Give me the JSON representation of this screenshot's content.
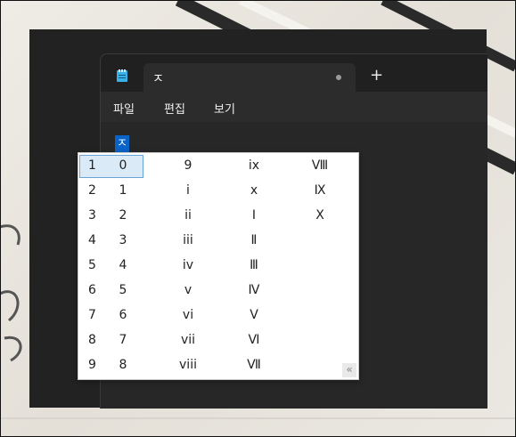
{
  "window": {
    "tab_title": "ㅈ",
    "new_tab_label": "+",
    "app_icon": "notepad-icon",
    "tab_modified_icon": "unsaved-dot-icon"
  },
  "menu": {
    "items": [
      "파일",
      "편집",
      "보기"
    ]
  },
  "editor": {
    "text": "ㅈ"
  },
  "ime": {
    "numbers": [
      "1",
      "2",
      "3",
      "4",
      "5",
      "6",
      "7",
      "8",
      "9"
    ],
    "columns": [
      [
        "0",
        "1",
        "2",
        "3",
        "4",
        "5",
        "6",
        "7",
        "8"
      ],
      [
        "9",
        "i",
        "ii",
        "iii",
        "iv",
        "v",
        "vi",
        "vii",
        "viii"
      ],
      [
        "ix",
        "x",
        "Ⅰ",
        "Ⅱ",
        "Ⅲ",
        "Ⅳ",
        "Ⅴ",
        "Ⅵ",
        "Ⅶ"
      ],
      [
        "Ⅷ",
        "Ⅸ",
        "Ⅹ",
        "",
        "",
        "",
        "",
        "",
        ""
      ]
    ],
    "expand_label": "«",
    "selected_index": 0
  },
  "colors": {
    "accent": "#0a64c8",
    "selection": "#dbeaf7",
    "window_bg": "#272727"
  }
}
